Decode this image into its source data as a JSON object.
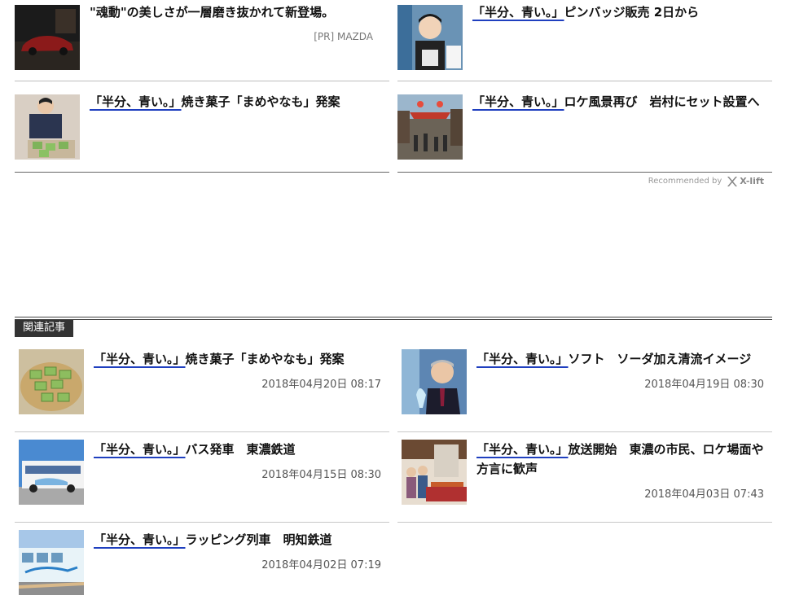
{
  "recommended": {
    "items": [
      {
        "title": "\"魂動\"の美しさが一層磨き抜かれて新登場。",
        "highlight": "",
        "rest": "\"魂動\"の美しさが一層磨き抜かれて新登場。",
        "sponsor": "[PR] MAZDA",
        "thumb": "car-photo"
      },
      {
        "title": "「半分、青い。」ピンバッジ販売 2日から",
        "highlight": "「半分、青い。」",
        "rest": "ピンバッジ販売 2日から",
        "thumb": "woman-photo"
      },
      {
        "title": "「半分、青い。」焼き菓子「まめやなも」発案",
        "highlight": "「半分、青い。」",
        "rest": "焼き菓子「まめやなも」発案",
        "thumb": "sweets-photo"
      },
      {
        "title": "「半分、青い。」ロケ風景再び 岩村にセット設置へ",
        "highlight": "「半分、青い。」",
        "rest": "ロケ風景再び　岩村にセット設置へ",
        "thumb": "street-photo"
      }
    ],
    "recommended_by": "Recommended by",
    "brand": "X-lift"
  },
  "related": {
    "heading": "関連記事",
    "items": [
      {
        "highlight": "「半分、青い。」",
        "rest": "焼き菓子「まめやなも」発案",
        "date": "2018年04月20日 08:17",
        "thumb": "sweets-photo"
      },
      {
        "highlight": "「半分、青い。」",
        "rest": "ソフト　ソーダ加え清流イメージ",
        "date": "2018年04月19日 08:30",
        "thumb": "man-photo"
      },
      {
        "highlight": "「半分、青い。」",
        "rest": "バス発車　東濃鉄道",
        "date": "2018年04月15日 08:30",
        "thumb": "bus-photo"
      },
      {
        "highlight": "「半分、青い。」",
        "rest": "放送開始　東濃の市民、ロケ場面や方言に歓声",
        "date": "2018年04月03日 07:43",
        "thumb": "crowd-photo"
      },
      {
        "highlight": "「半分、青い。」",
        "rest": "ラッピング列車　明知鉄道",
        "date": "2018年04月02日 07:19",
        "thumb": "train-photo"
      }
    ]
  },
  "colors": {
    "underline": "#1f3fbf",
    "tag_bg": "#333333"
  }
}
